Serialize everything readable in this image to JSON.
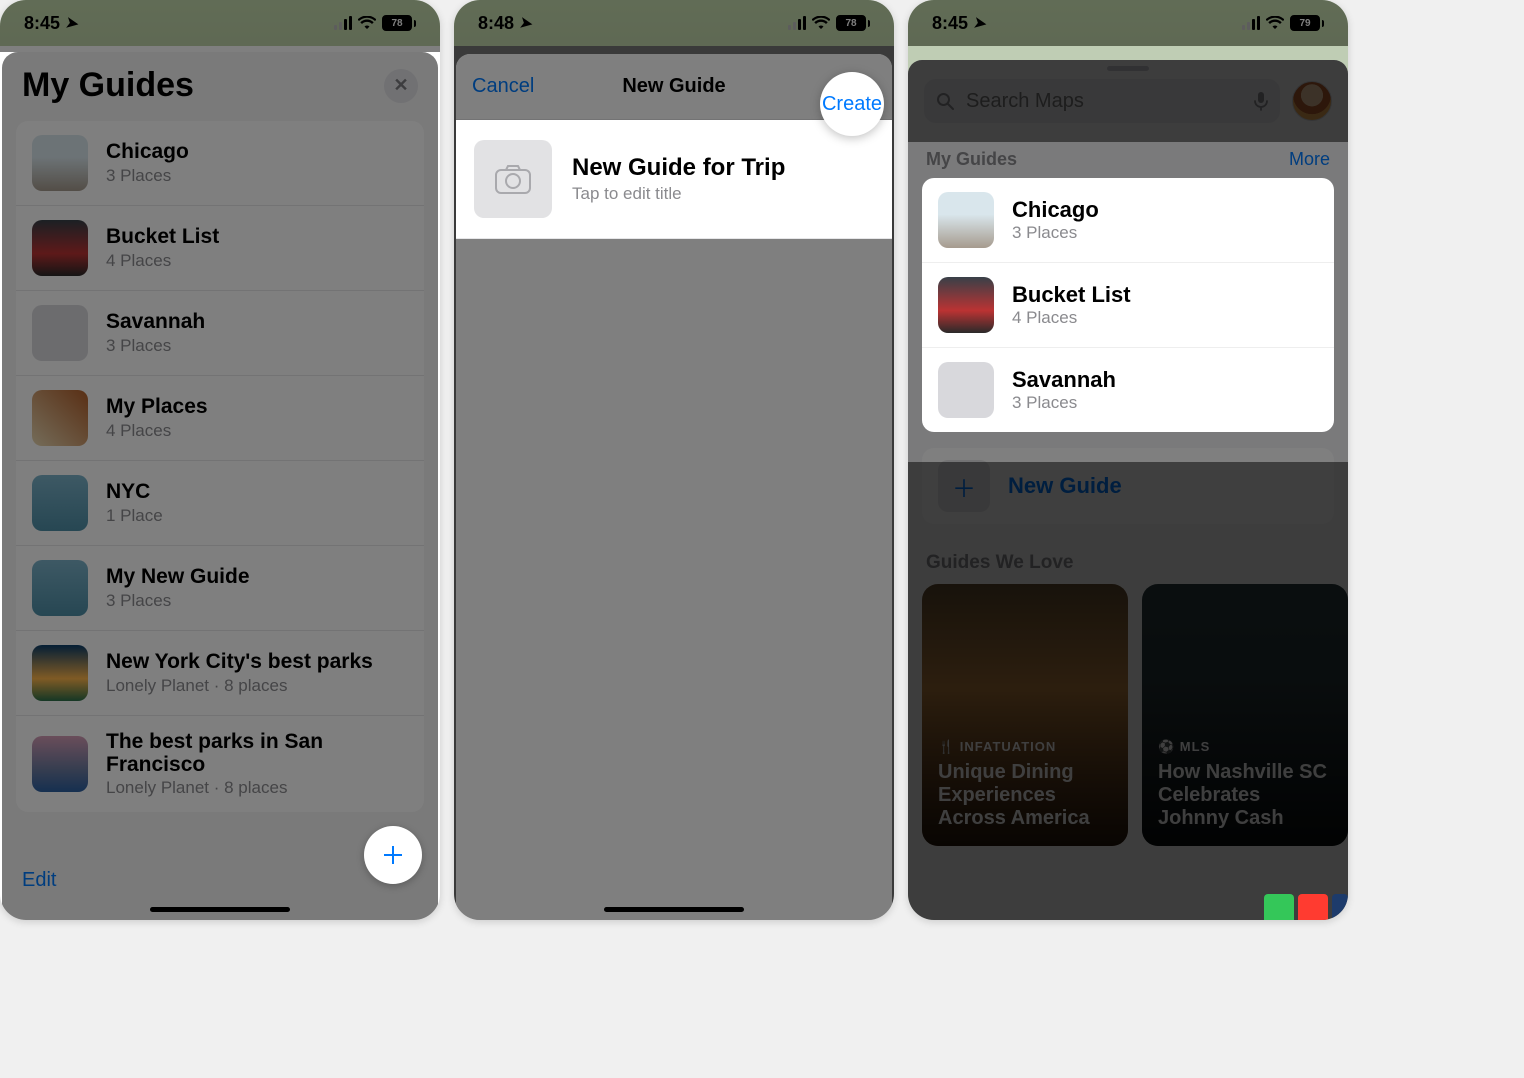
{
  "status": {
    "time_a": "8:45",
    "time_b": "8:48",
    "time_c": "8:45",
    "battery_a": "78",
    "battery_b": "78",
    "battery_c": "79"
  },
  "screen1": {
    "title": "My Guides",
    "guides": [
      {
        "name": "Chicago",
        "detail": "3 Places"
      },
      {
        "name": "Bucket List",
        "detail": "4 Places"
      },
      {
        "name": "Savannah",
        "detail": "3 Places"
      },
      {
        "name": "My Places",
        "detail": "4 Places"
      },
      {
        "name": "NYC",
        "detail": "1 Place"
      },
      {
        "name": "My New Guide",
        "detail": "3 Places"
      },
      {
        "name": "New York City's best parks",
        "detail": "Lonely Planet · 8 places"
      },
      {
        "name": "The best parks in San Francisco",
        "detail": "Lonely Planet · 8 places"
      }
    ],
    "edit": "Edit"
  },
  "screen2": {
    "cancel": "Cancel",
    "title": "New Guide",
    "create": "Create",
    "row_title": "New Guide for Trip",
    "row_sub": "Tap to edit title"
  },
  "screen3": {
    "search_placeholder": "Search Maps",
    "section_title": "My Guides",
    "more": "More",
    "guides": [
      {
        "name": "Chicago",
        "detail": "3 Places"
      },
      {
        "name": "Bucket List",
        "detail": "4 Places"
      },
      {
        "name": "Savannah",
        "detail": "3 Places"
      }
    ],
    "new_guide": "New Guide",
    "guides_love": "Guides We Love",
    "gl": [
      {
        "brand": "🍴 INFATUATION",
        "title": "Unique Dining Experiences Across America"
      },
      {
        "brand": "⚽ MLS",
        "title": "How Nashville SC Celebrates Johnny Cash"
      }
    ]
  }
}
